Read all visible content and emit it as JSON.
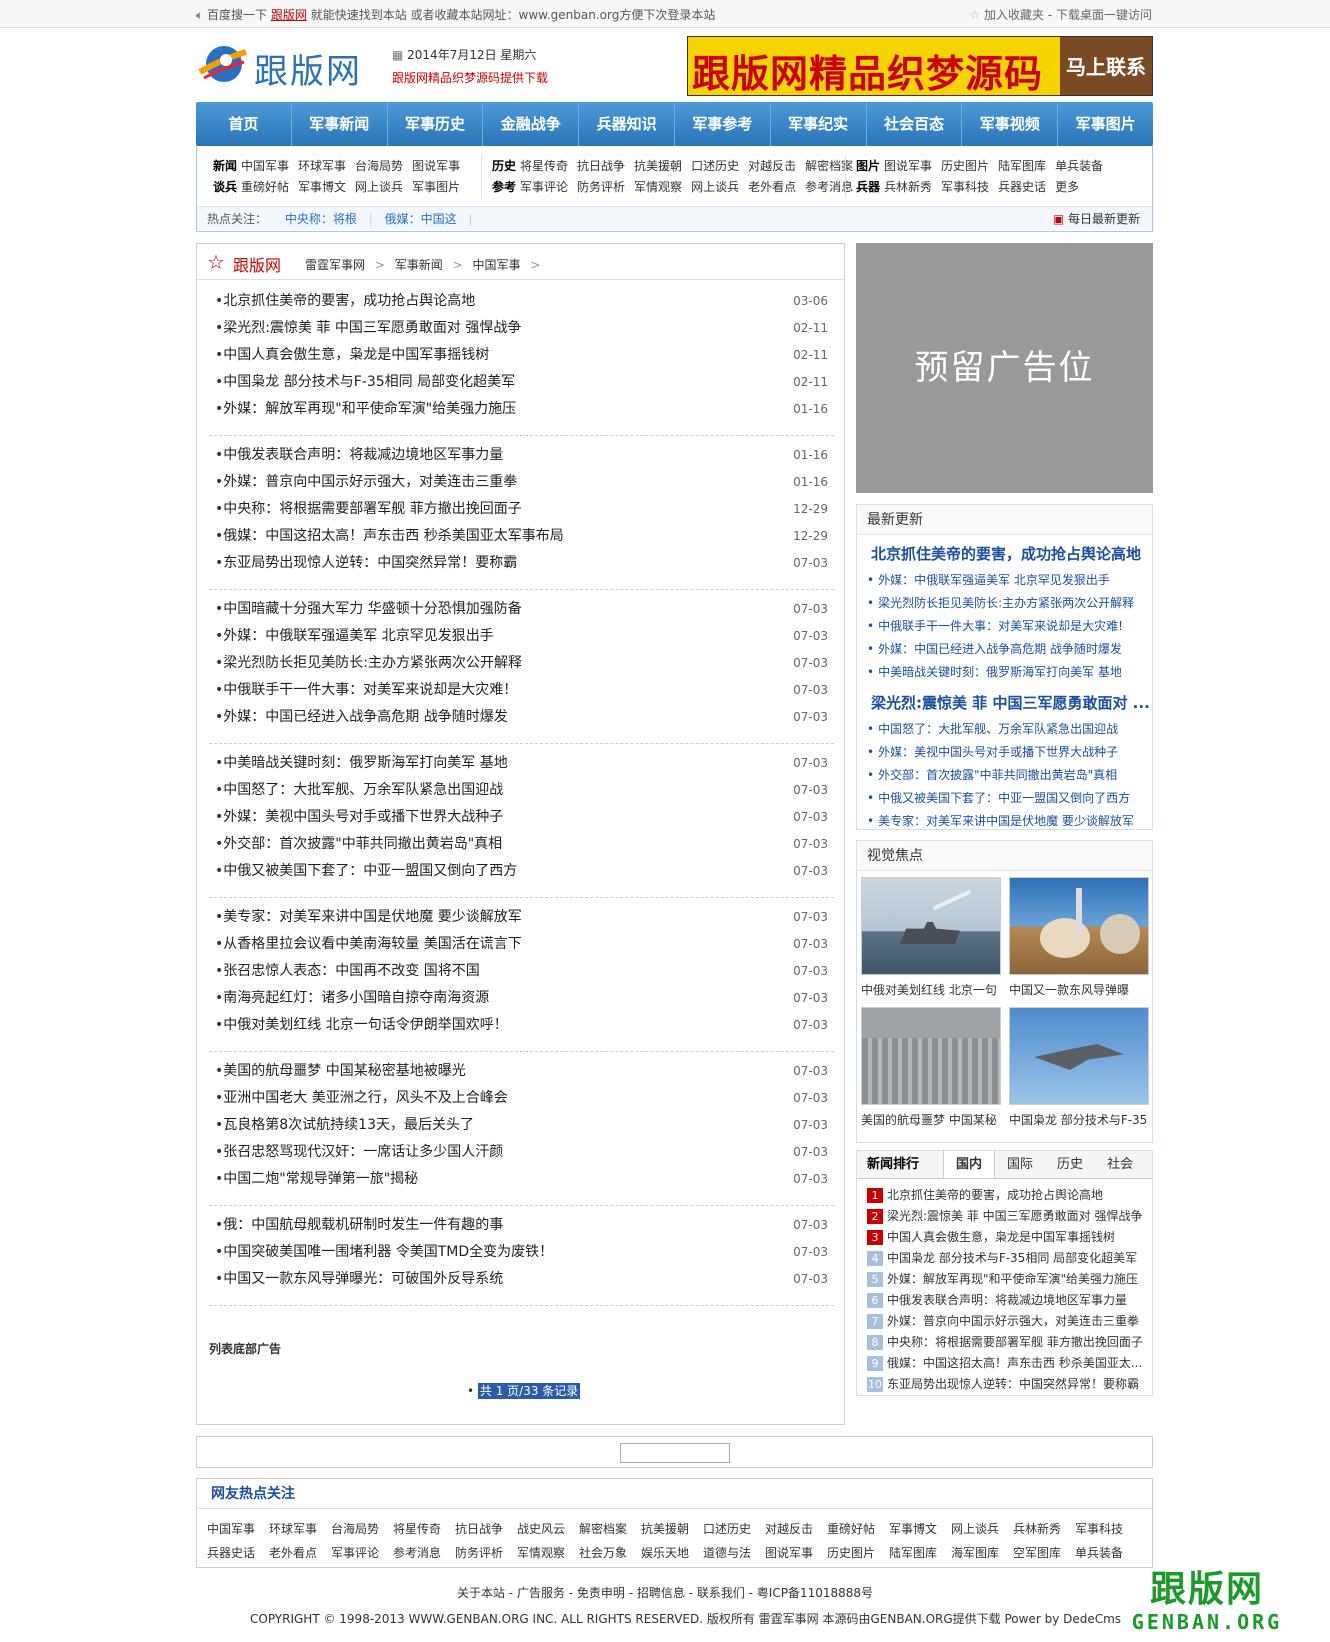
{
  "topbar": {
    "left_pre": "百度搜一下",
    "left_brand": "跟版网",
    "left_post": "就能快速找到本站 或者收藏本站网址：www.genban.org方便下次登录本站",
    "favorite": "加入收藏夹",
    "sep": " - ",
    "desktop": "下载桌面一键访问"
  },
  "header": {
    "logo_text": "跟版网",
    "date": "2014年7月12日 星期六",
    "slogan": "跟版网精品织梦源码提供下载",
    "banner_main": "跟版网精品织梦源码",
    "banner_cta": "马上联系"
  },
  "nav": [
    "首页",
    "军事新闻",
    "军事历史",
    "金融战争",
    "兵器知识",
    "军事参考",
    "军事纪实",
    "社会百态",
    "军事视频",
    "军事图片"
  ],
  "subnav": {
    "g1": {
      "r1_head": "新闻",
      "r1": [
        "中国军事",
        "环球军事",
        "台海局势",
        "图说军事"
      ],
      "r2_head": "谈兵",
      "r2": [
        "重磅好帖",
        "军事博文",
        "网上谈兵",
        "军事图片"
      ]
    },
    "g2": {
      "r1_head": "历史",
      "r1": [
        "将星传奇",
        "抗日战争",
        "抗美援朝",
        "口述历史",
        "对越反击",
        "解密档案"
      ],
      "r2_head": "参考",
      "r2": [
        "军事评论",
        "防务评析",
        "军情观察",
        "网上谈兵",
        "老外看点",
        "参考消息"
      ]
    },
    "g3": {
      "r1_head": "图片",
      "r1": [
        "图说军事",
        "历史图片",
        "陆军图库",
        "单兵装备"
      ],
      "r2_head": "兵器",
      "r2": [
        "兵林新秀",
        "军事科技",
        "兵器史话",
        "更多"
      ]
    },
    "hot_label": "热点关注：",
    "hot1": "中央称：将根",
    "hot2": "俄媒：中国这",
    "update": "每日最新更新"
  },
  "breadcrumb": {
    "logo": "跟版网",
    "p1": "雷霆军事网",
    "p2": "军事新闻",
    "p3": "中国军事",
    "arrow": ">"
  },
  "news_groups": [
    [
      {
        "t": "北京抓住美帝的要害，成功抢占舆论高地",
        "d": "03-06"
      },
      {
        "t": "梁光烈:震惊美 菲 中国三军愿勇敢面对 强悍战争",
        "d": "02-11"
      },
      {
        "t": "中国人真会傲生意，枭龙是中国军事摇钱树",
        "d": "02-11"
      },
      {
        "t": "中国枭龙 部分技术与F-35相同 局部变化超美军",
        "d": "02-11"
      },
      {
        "t": "外媒：解放军再现\"和平使命军演\"给美强力施压",
        "d": "01-16"
      }
    ],
    [
      {
        "t": "中俄发表联合声明：将裁减边境地区军事力量",
        "d": "01-16"
      },
      {
        "t": "外媒：普京向中国示好示强大，对美连击三重拳",
        "d": "01-16"
      },
      {
        "t": "中央称：将根据需要部署军舰 菲方撤出挽回面子",
        "d": "12-29"
      },
      {
        "t": "俄媒：中国这招太高！声东击西 秒杀美国亚太军事布局",
        "d": "12-29"
      },
      {
        "t": "东亚局势出现惊人逆转：中国突然异常！要称霸",
        "d": "07-03"
      }
    ],
    [
      {
        "t": "中国暗藏十分强大军力 华盛顿十分恐惧加强防备",
        "d": "07-03"
      },
      {
        "t": "外媒：中俄联军强逼美军 北京罕见发狠出手",
        "d": "07-03"
      },
      {
        "t": "梁光烈防长拒见美防长:主办方紧张两次公开解释",
        "d": "07-03"
      },
      {
        "t": "中俄联手干一件大事：对美军来说却是大灾难！",
        "d": "07-03"
      },
      {
        "t": "外媒：中国已经进入战争高危期 战争随时爆发",
        "d": "07-03"
      }
    ],
    [
      {
        "t": "中美暗战关键时刻：俄罗斯海军打向美军 基地",
        "d": "07-03"
      },
      {
        "t": "中国怒了：大批军舰、万余军队紧急出国迎战",
        "d": "07-03"
      },
      {
        "t": "外媒：美视中国头号对手或播下世界大战种子",
        "d": "07-03"
      },
      {
        "t": "外交部：首次披露\"中菲共同撤出黄岩岛\"真相",
        "d": "07-03"
      },
      {
        "t": "中俄又被美国下套了：中亚一盟国又倒向了西方",
        "d": "07-03"
      }
    ],
    [
      {
        "t": "美专家：对美军来讲中国是伏地魔 要少谈解放军",
        "d": "07-03"
      },
      {
        "t": "从香格里拉会议看中美南海较量 美国活在谎言下",
        "d": "07-03"
      },
      {
        "t": "张召忠惊人表态：中国再不改变 国将不国",
        "d": "07-03"
      },
      {
        "t": "南海亮起红灯：诸多小国暗自掠夺南海资源",
        "d": "07-03"
      },
      {
        "t": "中俄对美划红线 北京一句话令伊朗举国欢呼！",
        "d": "07-03"
      }
    ],
    [
      {
        "t": "美国的航母噩梦 中国某秘密基地被曝光",
        "d": "07-03"
      },
      {
        "t": "亚洲中国老大 美亚洲之行，风头不及上合峰会",
        "d": "07-03"
      },
      {
        "t": "瓦良格第8次试航持续13天，最后关头了",
        "d": "07-03"
      },
      {
        "t": "张召忠怒骂现代汉奸：一席话让多少国人汗颜",
        "d": "07-03"
      },
      {
        "t": "中国二炮\"常规导弹第一旅\"揭秘",
        "d": "07-03"
      }
    ],
    [
      {
        "t": "俄：中国航母舰载机研制时发生一件有趣的事",
        "d": "07-03"
      },
      {
        "t": "中国突破美国唯一围堵利器 令美国TMD全变为废铁！",
        "d": "07-03"
      },
      {
        "t": "中国又一款东风导弹曝光：可破国外反导系统",
        "d": "07-03"
      }
    ]
  ],
  "list_ad": "列表底部广告",
  "pager": "共 1 页/33 条记录",
  "ad_reserved": "预留广告位",
  "latest": {
    "title": "最新更新",
    "big1": "北京抓住美帝的要害，成功抢占舆论高地",
    "items1": [
      "外媒：中俄联军强逼美军 北京罕见发狠出手",
      "梁光烈防长拒见美防长:主办方紧张两次公开解释",
      "中俄联手干一件大事：对美军来说却是大灾难!",
      "外媒：中国已经进入战争高危期 战争随时爆发",
      "中美暗战关键时刻：俄罗斯海军打向美军 基地"
    ],
    "big2": "梁光烈:震惊美 菲 中国三军愿勇敢面对 ...",
    "items2": [
      "中国怒了：大批军舰、万余军队紧急出国迎战",
      "外媒：美视中国头号对手或播下世界大战种子",
      "外交部：首次披露\"中菲共同撤出黄岩岛\"真相",
      "中俄又被美国下套了：中亚一盟国又倒向了西方",
      "美专家：对美军来讲中国是伏地魔 要少谈解放军"
    ]
  },
  "visual": {
    "title": "视觉焦点",
    "caps": [
      "中俄对美划红线 北京一句",
      "中国又一款东风导弹曝",
      "美国的航母噩梦 中国某秘",
      "中国枭龙 部分技术与F-35"
    ]
  },
  "rank": {
    "title": "新闻排行",
    "tabs": [
      "国内",
      "国际",
      "历史",
      "社会"
    ],
    "items": [
      "北京抓住美帝的要害，成功抢占舆论高地",
      "梁光烈:震惊美 菲 中国三军愿勇敢面对 强悍战争",
      "中国人真会傲生意，枭龙是中国军事摇钱树",
      "中国枭龙 部分技术与F-35相同 局部变化超美军",
      "外媒：解放军再现\"和平使命军演\"给美强力施压",
      "中俄发表联合声明：将裁减边境地区军事力量",
      "外媒：普京向中国示好示强大，对美连击三重拳",
      "中央称：将根据需要部署军舰 菲方撤出挽回面子",
      "俄媒：中国这招太高！声东击西 秒杀美国亚太...",
      "东亚局势出现惊人逆转：中国突然异常！要称霸"
    ]
  },
  "hot": {
    "title": "网友热点关注",
    "row1": [
      "中国军事",
      "环球军事",
      "台海局势",
      "将星传奇",
      "抗日战争",
      "战史风云",
      "解密档案",
      "抗美援朝",
      "口述历史",
      "对越反击",
      "重磅好帖",
      "军事博文",
      "网上谈兵",
      "兵林新秀",
      "军事科技"
    ],
    "row2": [
      "兵器史话",
      "老外看点",
      "军事评论",
      "参考消息",
      "防务评析",
      "军情观察",
      "社会万象",
      "娱乐天地",
      "道德与法",
      "图说军事",
      "历史图片",
      "陆军图库",
      "海军图库",
      "空军图库",
      "单兵装备"
    ]
  },
  "footer": {
    "links": "关于本站 - 广告服务 - 免责申明 - 招聘信息 - 联系我们 - 粤ICP备11018888号",
    "copyright": "COPYRIGHT © 1998-2013 WWW.GENBAN.ORG INC. ALL RIGHTS RESERVED. 版权所有 雷霆军事网 本源码由GENBAN.ORG提供下载 Power by DedeCms",
    "wm_cn": "跟版网",
    "wm_en": "GENBAN.ORG"
  }
}
